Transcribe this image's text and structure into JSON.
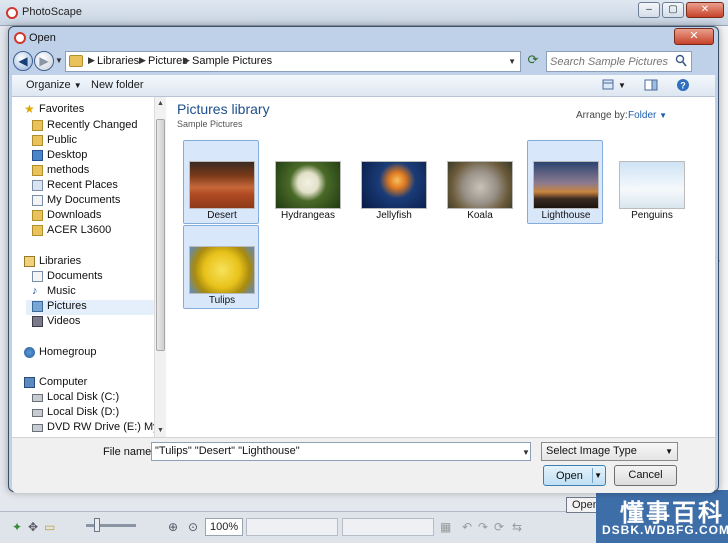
{
  "background_app": {
    "title": "PhotoScape",
    "zoom_value": "100%",
    "open_button_partial": "Open Co"
  },
  "watermark": {
    "text_cn": "懂事百科",
    "url": "DSBK.WDBFG.COM"
  },
  "dialog": {
    "title": "Open",
    "breadcrumb": [
      "Libraries",
      "Pictures",
      "Sample Pictures"
    ],
    "search_placeholder": "Search Sample Pictures",
    "toolbar": {
      "organize_label": "Organize",
      "new_folder_label": "New folder"
    },
    "nav": {
      "favorites_header": "Favorites",
      "favorites": [
        "Recently Changed",
        "Public",
        "Desktop",
        "methods",
        "Recent Places",
        "My Documents",
        "Downloads",
        "ACER L3600"
      ],
      "libraries_header": "Libraries",
      "libraries": [
        "Documents",
        "Music",
        "Pictures",
        "Videos"
      ],
      "homegroup": "Homegroup",
      "computer_header": "Computer",
      "drives": [
        "Local Disk (C:)",
        "Local Disk (D:)",
        "DVD RW Drive (E:) My Disc"
      ],
      "selected": "Pictures"
    },
    "library": {
      "title": "Pictures library",
      "subtitle": "Sample Pictures",
      "arrange_label": "Arrange by:",
      "arrange_value": "Folder"
    },
    "files": [
      {
        "name": "Desert",
        "selected": true
      },
      {
        "name": "Hydrangeas",
        "selected": false
      },
      {
        "name": "Jellyfish",
        "selected": false
      },
      {
        "name": "Koala",
        "selected": false
      },
      {
        "name": "Lighthouse",
        "selected": true
      },
      {
        "name": "Penguins",
        "selected": false
      },
      {
        "name": "Tulips",
        "selected": true
      }
    ],
    "file_name_label": "File name:",
    "file_name_value": "\"Tulips\" \"Desert\" \"Lighthouse\"",
    "file_type_value": "Select Image Type",
    "open_label": "Open",
    "cancel_label": "Cancel"
  }
}
